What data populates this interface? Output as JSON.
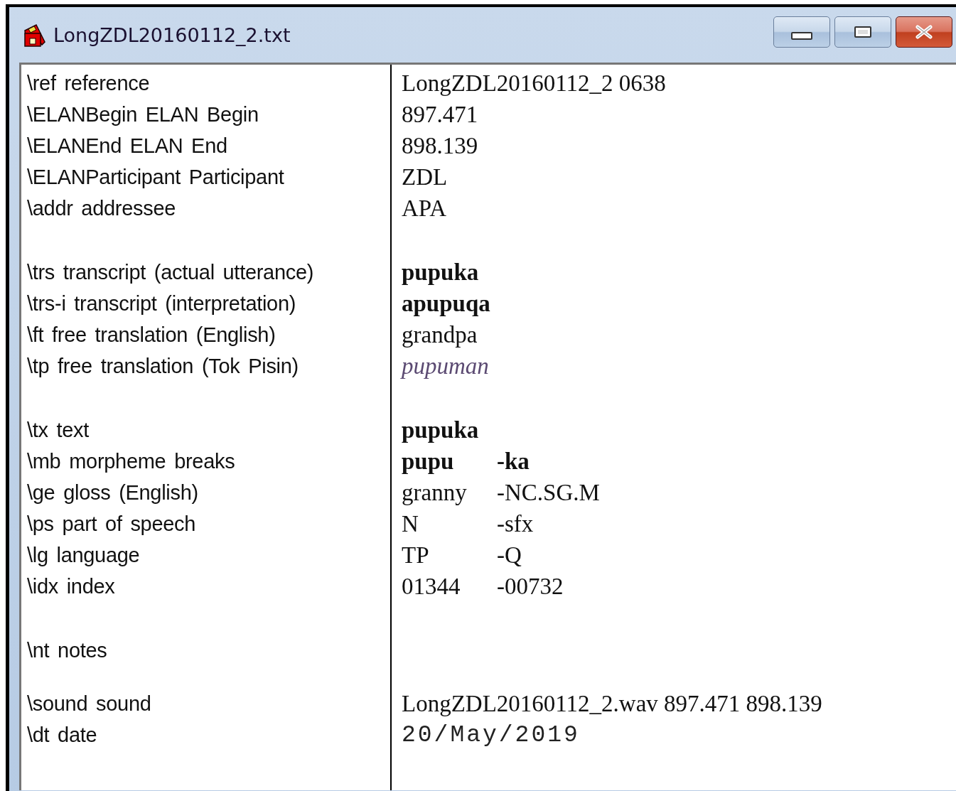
{
  "window": {
    "title": "LongZDL20160112_2.txt"
  },
  "groups": [
    {
      "rows": [
        {
          "label": "\\ref reference",
          "kind": "plain",
          "values": [
            "LongZDL20160112_2 0638"
          ]
        },
        {
          "label": "\\ELANBegin ELAN Begin",
          "kind": "plain",
          "values": [
            "897.471"
          ]
        },
        {
          "label": "\\ELANEnd ELAN End",
          "kind": "plain",
          "values": [
            "898.139"
          ]
        },
        {
          "label": "\\ELANParticipant Participant",
          "kind": "plain",
          "values": [
            "ZDL"
          ]
        },
        {
          "label": "\\addr addressee",
          "kind": "plain",
          "values": [
            "APA"
          ]
        }
      ]
    },
    {
      "rows": [
        {
          "label": "\\trs transcript (actual utterance)",
          "kind": "bold",
          "values": [
            "pupuka"
          ]
        },
        {
          "label": "\\trs-i transcript (interpretation)",
          "kind": "bold",
          "values": [
            "apupuqa"
          ]
        },
        {
          "label": "\\ft free translation (English)",
          "kind": "plain",
          "values": [
            "grandpa"
          ]
        },
        {
          "label": "\\tp free translation (Tok Pisin)",
          "kind": "italic",
          "values": [
            "pupuman"
          ]
        }
      ]
    },
    {
      "rows": [
        {
          "label": "\\tx text",
          "kind": "bold",
          "values": [
            "pupuka"
          ]
        },
        {
          "label": "\\mb morpheme breaks",
          "kind": "bold",
          "values": [
            "pupu",
            "-ka"
          ]
        },
        {
          "label": "\\ge gloss (English)",
          "kind": "plain",
          "values": [
            "granny",
            "-NC.SG.M"
          ]
        },
        {
          "label": "\\ps part of speech",
          "kind": "plain",
          "values": [
            "N",
            "-sfx"
          ]
        },
        {
          "label": "\\lg language",
          "kind": "plain",
          "values": [
            "TP",
            "-Q"
          ]
        },
        {
          "label": "\\idx index",
          "kind": "plain",
          "values": [
            "01344",
            "-00732"
          ]
        }
      ]
    },
    {
      "rows": [
        {
          "label": "\\nt notes",
          "kind": "plain",
          "values": []
        }
      ]
    },
    {
      "rows": [
        {
          "label": "\\sound sound",
          "kind": "plain",
          "values": [
            "LongZDL20160112_2.wav 897.471 898.139"
          ]
        },
        {
          "label": "\\dt date",
          "kind": "mono",
          "values": [
            "20/May/2019"
          ]
        }
      ]
    }
  ]
}
